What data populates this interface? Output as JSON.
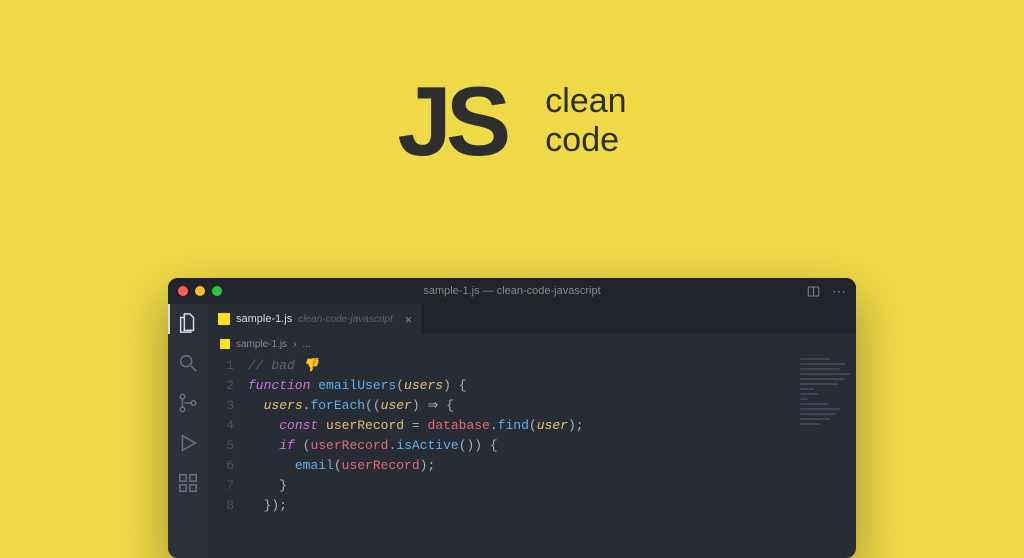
{
  "hero": {
    "logo": "JS",
    "tagline_line1": "clean",
    "tagline_line2": "code"
  },
  "titlebar": {
    "title": "sample-1.js — clean-code-javascript"
  },
  "tab": {
    "filename": "sample-1.js",
    "folder": "clean-code-javascript",
    "close": "×"
  },
  "breadcrumb": {
    "filename": "sample-1.js",
    "sep": "›",
    "rest": "..."
  },
  "code": {
    "lines": [
      {
        "n": "1",
        "indent": "",
        "tokens": [
          [
            "comment",
            "// bad 👎"
          ]
        ]
      },
      {
        "n": "2",
        "indent": "",
        "tokens": [
          [
            "keyword",
            "function "
          ],
          [
            "func",
            "emailUsers"
          ],
          [
            "plain",
            "("
          ],
          [
            "param",
            "users"
          ],
          [
            "plain",
            ") {"
          ]
        ]
      },
      {
        "n": "3",
        "indent": "  ",
        "tokens": [
          [
            "param",
            "users"
          ],
          [
            "plain",
            "."
          ],
          [
            "method",
            "forEach"
          ],
          [
            "plain",
            "(("
          ],
          [
            "param",
            "user"
          ],
          [
            "plain",
            ") ⇒ {"
          ]
        ]
      },
      {
        "n": "4",
        "indent": "    ",
        "tokens": [
          [
            "keyword",
            "const "
          ],
          [
            "var",
            "userRecord"
          ],
          [
            "plain",
            " = "
          ],
          [
            "prop",
            "database"
          ],
          [
            "plain",
            "."
          ],
          [
            "method",
            "find"
          ],
          [
            "plain",
            "("
          ],
          [
            "param",
            "user"
          ],
          [
            "plain",
            ");"
          ]
        ]
      },
      {
        "n": "5",
        "indent": "    ",
        "tokens": [
          [
            "keyword",
            "if "
          ],
          [
            "plain",
            "("
          ],
          [
            "prop",
            "userRecord"
          ],
          [
            "plain",
            "."
          ],
          [
            "method",
            "isActive"
          ],
          [
            "plain",
            "()) {"
          ]
        ]
      },
      {
        "n": "6",
        "indent": "      ",
        "tokens": [
          [
            "method",
            "email"
          ],
          [
            "plain",
            "("
          ],
          [
            "prop",
            "userRecord"
          ],
          [
            "plain",
            ");"
          ]
        ]
      },
      {
        "n": "7",
        "indent": "    ",
        "tokens": [
          [
            "plain",
            "}"
          ]
        ]
      },
      {
        "n": "8",
        "indent": "  ",
        "tokens": [
          [
            "plain",
            "});"
          ]
        ]
      }
    ]
  },
  "activity_icons": [
    "files-icon",
    "search-icon",
    "source-control-icon",
    "run-debug-icon",
    "extensions-icon"
  ],
  "minimap_widths": [
    30,
    45,
    40,
    50,
    44,
    38,
    14,
    18,
    8,
    28,
    40,
    36,
    30,
    20
  ]
}
